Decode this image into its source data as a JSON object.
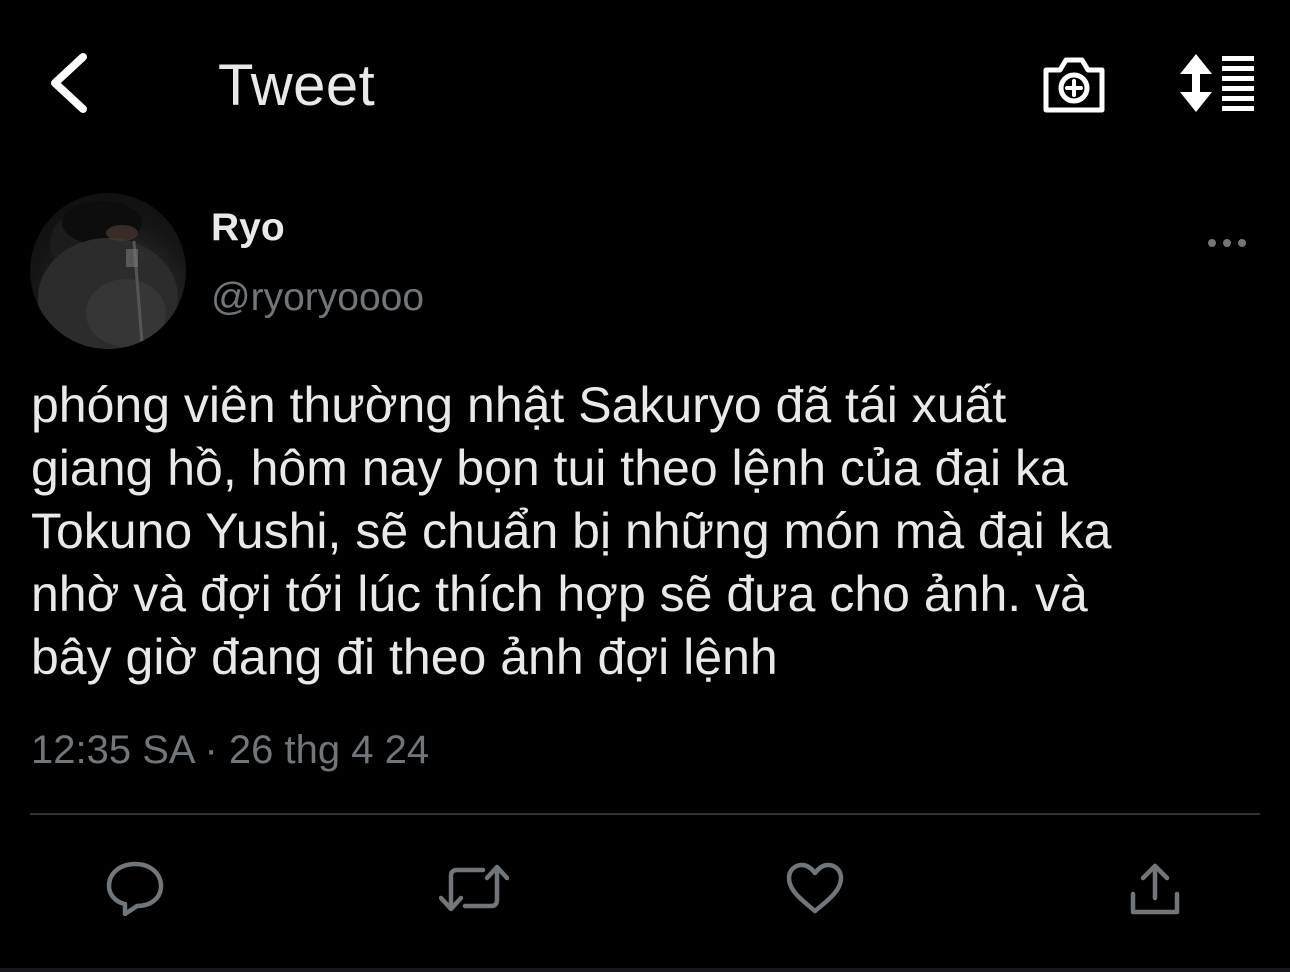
{
  "header": {
    "title": "Tweet",
    "back_icon": "chevron-left-icon",
    "camera_icon": "camera-plus-icon",
    "sort_icon": "sort-list-icon"
  },
  "author": {
    "name": "Ryo",
    "handle": "@ryoryoooo",
    "avatar": "user-avatar"
  },
  "tweet": {
    "text": "phóng viên thường nhật Sakuryo đã tái xuất\ngiang hồ, hôm nay bọn tui theo lệnh của đại ka\nTokuno Yushi, sẽ chuẩn bị những món mà đại ka\nnhờ và đợi tới lúc thích hợp sẽ đưa cho ảnh. và\nbây giờ đang đi theo ảnh đợi lệnh",
    "timestamp": "12:35 SA · 26 thg 4 24"
  },
  "actions": [
    {
      "name": "reply",
      "icon": "reply-icon"
    },
    {
      "name": "retweet",
      "icon": "retweet-icon"
    },
    {
      "name": "like",
      "icon": "heart-icon"
    },
    {
      "name": "share",
      "icon": "share-icon"
    }
  ],
  "colors": {
    "background": "#000000",
    "text": "#e7e9ea",
    "secondary": "#71767b",
    "divider": "#2f3336"
  }
}
